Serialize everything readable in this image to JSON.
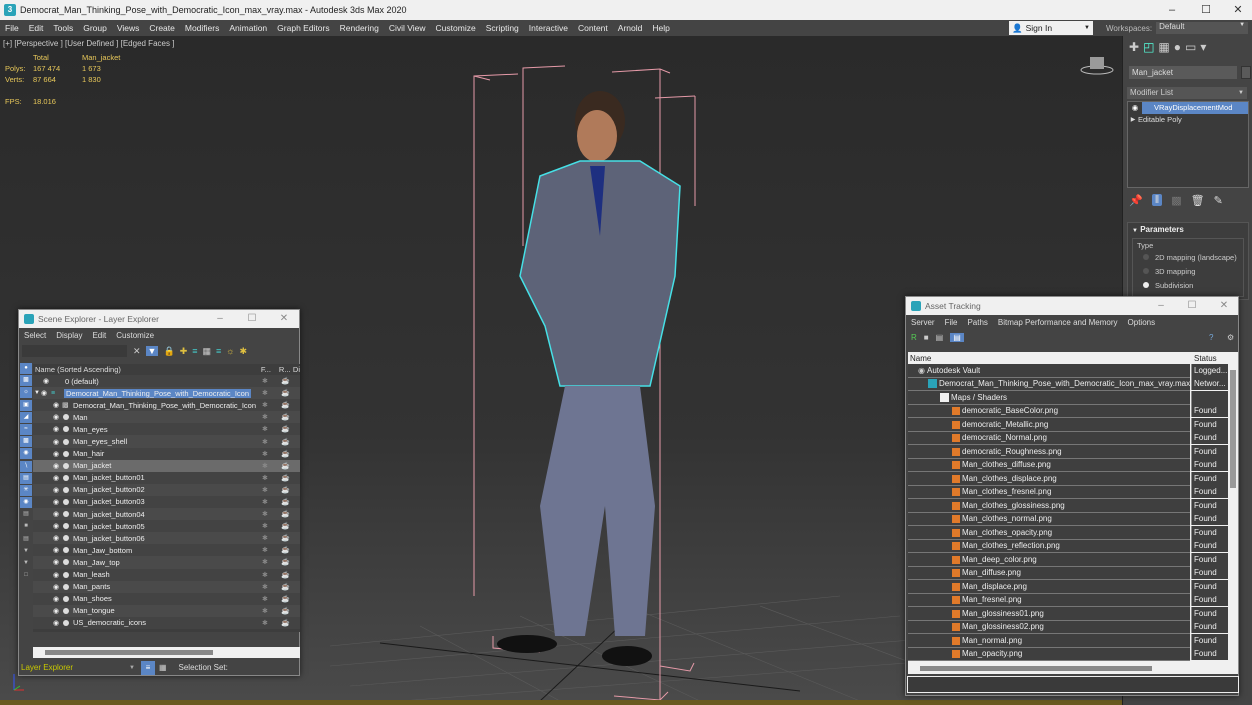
{
  "window": {
    "title": "Democrat_Man_Thinking_Pose_with_Democratic_Icon_max_vray.max - Autodesk 3ds Max 2020",
    "controls": [
      "minimize",
      "maximize",
      "close"
    ]
  },
  "menubar": [
    "File",
    "Edit",
    "Tools",
    "Group",
    "Views",
    "Create",
    "Modifiers",
    "Animation",
    "Graph Editors",
    "Rendering",
    "Civil View",
    "Customize",
    "Scripting",
    "Interactive",
    "Content",
    "Arnold",
    "Help"
  ],
  "signin": {
    "label": "Sign In"
  },
  "workspaces": {
    "label": "Workspaces:",
    "value": "Default"
  },
  "viewport": {
    "label": "[+] [Perspective ] [User Defined ] [Edged Faces ]",
    "stats": {
      "headers": [
        "",
        "Total",
        "Man_jacket"
      ],
      "rows": [
        [
          "Polys:",
          "167 474",
          "1 673"
        ],
        [
          "Verts:",
          "87 664",
          "1 830"
        ]
      ]
    },
    "fps_label": "FPS:",
    "fps_value": "18.016",
    "selection_color": "#46e0e6",
    "bbox_color": "#e59aa8"
  },
  "command_panel": {
    "object_name": "Man_jacket",
    "modifier_list_label": "Modifier List",
    "stack": [
      {
        "label": "VRayDisplacementMod",
        "selected": true
      },
      {
        "label": "Editable Poly",
        "selected": false
      }
    ],
    "rollout_title": "Parameters",
    "type_group_label": "Type",
    "type_options": [
      {
        "label": "2D mapping (landscape)",
        "checked": false
      },
      {
        "label": "3D mapping",
        "checked": false
      },
      {
        "label": "Subdivision",
        "checked": true
      }
    ]
  },
  "scene_explorer": {
    "title": "Scene Explorer - Layer Explorer",
    "menu": [
      "Select",
      "Display",
      "Edit",
      "Customize"
    ],
    "columns": [
      "Name (Sorted Ascending)",
      "F...",
      "R...",
      "Di"
    ],
    "rows": [
      {
        "name": "0 (default)",
        "level": 0,
        "type": "layer"
      },
      {
        "name": "Democrat_Man_Thinking_Pose_with_Democratic_Icon",
        "level": 0,
        "type": "layer-active"
      },
      {
        "name": "Democrat_Man_Thinking_Pose_with_Democratic_Icon",
        "level": 1,
        "type": "group"
      },
      {
        "name": "Man",
        "level": 1,
        "type": "object"
      },
      {
        "name": "Man_eyes",
        "level": 1,
        "type": "object"
      },
      {
        "name": "Man_eyes_shell",
        "level": 1,
        "type": "object"
      },
      {
        "name": "Man_hair",
        "level": 1,
        "type": "object"
      },
      {
        "name": "Man_jacket",
        "level": 1,
        "type": "object",
        "selected": true
      },
      {
        "name": "Man_jacket_button01",
        "level": 1,
        "type": "object"
      },
      {
        "name": "Man_jacket_button02",
        "level": 1,
        "type": "object"
      },
      {
        "name": "Man_jacket_button03",
        "level": 1,
        "type": "object"
      },
      {
        "name": "Man_jacket_button04",
        "level": 1,
        "type": "object"
      },
      {
        "name": "Man_jacket_button05",
        "level": 1,
        "type": "object"
      },
      {
        "name": "Man_jacket_button06",
        "level": 1,
        "type": "object"
      },
      {
        "name": "Man_Jaw_bottom",
        "level": 1,
        "type": "object"
      },
      {
        "name": "Man_Jaw_top",
        "level": 1,
        "type": "object"
      },
      {
        "name": "Man_leash",
        "level": 1,
        "type": "object"
      },
      {
        "name": "Man_pants",
        "level": 1,
        "type": "object"
      },
      {
        "name": "Man_shoes",
        "level": 1,
        "type": "object"
      },
      {
        "name": "Man_tongue",
        "level": 1,
        "type": "object"
      },
      {
        "name": "US_democratic_icons",
        "level": 1,
        "type": "object"
      }
    ],
    "footer_mode": "Layer Explorer",
    "selection_set_label": "Selection Set:"
  },
  "asset_tracking": {
    "title": "Asset Tracking",
    "menu": [
      "Server",
      "File",
      "Paths",
      "Bitmap Performance and Memory",
      "Options"
    ],
    "columns": [
      "Name",
      "Status"
    ],
    "rows": [
      {
        "name": "Autodesk Vault",
        "status": "Logged...",
        "level": 0,
        "icon": "vault"
      },
      {
        "name": "Democrat_Man_Thinking_Pose_with_Democratic_Icon_max_vray.max",
        "status": "Networ...",
        "level": 1,
        "icon": "max"
      },
      {
        "name": "Maps / Shaders",
        "status": "",
        "level": 2,
        "icon": "maps"
      },
      {
        "name": "democratic_BaseColor.png",
        "status": "Found",
        "level": 3,
        "icon": "png"
      },
      {
        "name": "democratic_Metallic.png",
        "status": "Found",
        "level": 3,
        "icon": "png"
      },
      {
        "name": "democratic_Normal.png",
        "status": "Found",
        "level": 3,
        "icon": "png"
      },
      {
        "name": "democratic_Roughness.png",
        "status": "Found",
        "level": 3,
        "icon": "png"
      },
      {
        "name": "Man_clothes_diffuse.png",
        "status": "Found",
        "level": 3,
        "icon": "png"
      },
      {
        "name": "Man_clothes_displace.png",
        "status": "Found",
        "level": 3,
        "icon": "png"
      },
      {
        "name": "Man_clothes_fresnel.png",
        "status": "Found",
        "level": 3,
        "icon": "png"
      },
      {
        "name": "Man_clothes_glossiness.png",
        "status": "Found",
        "level": 3,
        "icon": "png"
      },
      {
        "name": "Man_clothes_normal.png",
        "status": "Found",
        "level": 3,
        "icon": "png"
      },
      {
        "name": "Man_clothes_opacity.png",
        "status": "Found",
        "level": 3,
        "icon": "png"
      },
      {
        "name": "Man_clothes_reflection.png",
        "status": "Found",
        "level": 3,
        "icon": "png"
      },
      {
        "name": "Man_deep_color.png",
        "status": "Found",
        "level": 3,
        "icon": "png"
      },
      {
        "name": "Man_diffuse.png",
        "status": "Found",
        "level": 3,
        "icon": "png"
      },
      {
        "name": "Man_displace.png",
        "status": "Found",
        "level": 3,
        "icon": "png"
      },
      {
        "name": "Man_fresnel.png",
        "status": "Found",
        "level": 3,
        "icon": "png"
      },
      {
        "name": "Man_glossiness01.png",
        "status": "Found",
        "level": 3,
        "icon": "png"
      },
      {
        "name": "Man_glossiness02.png",
        "status": "Found",
        "level": 3,
        "icon": "png"
      },
      {
        "name": "Man_normal.png",
        "status": "Found",
        "level": 3,
        "icon": "png"
      },
      {
        "name": "Man_opacity.png",
        "status": "Found",
        "level": 3,
        "icon": "png"
      }
    ],
    "path_value": ""
  }
}
